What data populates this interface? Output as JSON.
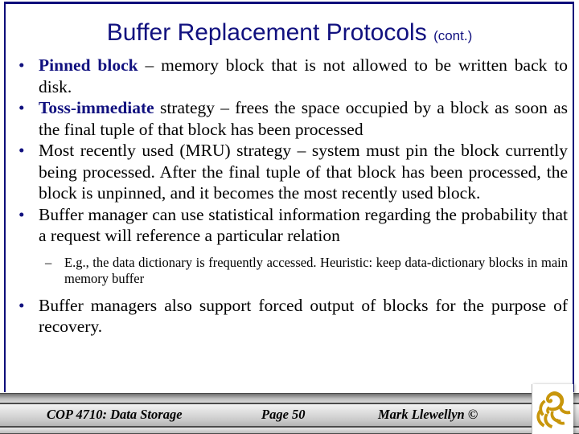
{
  "slide": {
    "title_main": "Buffer Replacement Protocols",
    "title_suffix": "(cont.)",
    "title_color": "#11117f",
    "accent_color": "#11117f",
    "frame_color": "#0d0d7a",
    "bullet_glyph": "•",
    "dash_glyph": "–",
    "bullets": [
      {
        "highlight": "Pinned block",
        "rest": " – memory block that is not allowed to be written back to disk."
      },
      {
        "highlight": "Toss-immediate",
        "rest": " strategy – frees the space occupied by a block as soon as the final tuple of that block has been processed"
      },
      {
        "highlight": "",
        "rest": "Most recently used (MRU) strategy –  system must pin the block currently being processed.  After the final tuple of that block has been processed, the block is unpinned, and it becomes the most recently used block."
      },
      {
        "highlight": "",
        "rest": "Buffer manager can use statistical information regarding the probability that a request will reference a particular relation"
      }
    ],
    "sub_bullet": "E.g., the data dictionary is frequently accessed.  Heuristic:  keep data-dictionary blocks in main memory buffer",
    "last_bullet": "Buffer managers also support forced output of blocks for the purpose of recovery."
  },
  "footer": {
    "course": "COP 4710: Data Storage",
    "page": "Page 50",
    "author": "Mark Llewellyn ©",
    "logo_name": "ucf-pegasus-logo",
    "logo_color": "#c8960c"
  }
}
